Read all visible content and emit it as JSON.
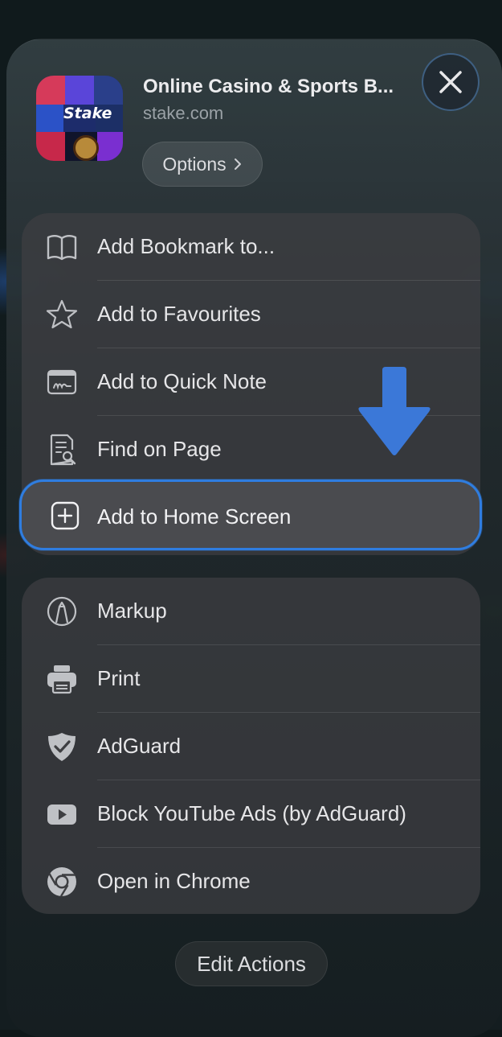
{
  "header": {
    "title": "Online Casino & Sports B...",
    "domain": "stake.com",
    "app_icon_text": "Stake",
    "options_label": "Options",
    "close_label": "Close"
  },
  "group1": {
    "items": [
      {
        "label": "Add Bookmark to...",
        "icon": "book-icon"
      },
      {
        "label": "Add to Favourites",
        "icon": "star-icon"
      },
      {
        "label": "Add to Quick Note",
        "icon": "quick-note-icon"
      },
      {
        "label": "Find on Page",
        "icon": "find-on-page-icon"
      }
    ]
  },
  "highlighted": {
    "label": "Add to Home Screen",
    "icon": "plus-square-icon",
    "accent": "#2f7de0"
  },
  "group2": {
    "items": [
      {
        "label": "Markup",
        "icon": "markup-pen-icon"
      },
      {
        "label": "Print",
        "icon": "printer-icon"
      },
      {
        "label": "AdGuard",
        "icon": "shield-check-icon"
      },
      {
        "label": "Block YouTube Ads (by AdGuard)",
        "icon": "youtube-play-icon"
      },
      {
        "label": "Open in Chrome",
        "icon": "chrome-icon"
      }
    ]
  },
  "footer": {
    "edit_actions_label": "Edit Actions"
  },
  "colors": {
    "arrow": "#3b78d8",
    "highlight_border": "#2f7de0"
  }
}
